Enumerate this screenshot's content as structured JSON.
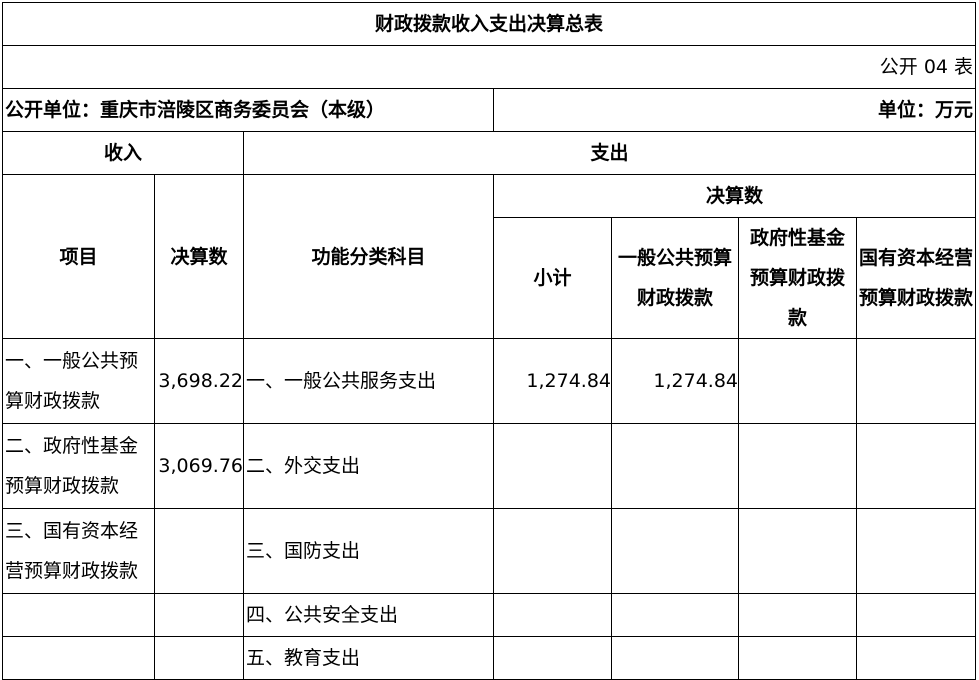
{
  "title": "财政拨款收入支出决算总表",
  "table_no": "公开 04 表",
  "unit_org": "公开单位：重庆市涪陵区商务委员会（本级）",
  "unit": "单位：万元",
  "headers": {
    "income": "收入",
    "expense": "支出",
    "item": "项目",
    "amount": "决算数",
    "func": "功能分类科目",
    "final": "决算数",
    "subtotal": "小计",
    "general": "一般公共预算财政拨款",
    "gov_fund": "政府性基金预算财政拨款",
    "state_capital": "国有资本经营预算财政拨款"
  },
  "rows": [
    {
      "income_item": "一、一般公共预算财政拨款",
      "income_amount": "3,698.22",
      "func": "一、一般公共服务支出",
      "subtotal": "1,274.84",
      "general": "1,274.84",
      "gov_fund": "",
      "state_capital": ""
    },
    {
      "income_item": "二、政府性基金预算财政拨款",
      "income_amount": "3,069.76",
      "func": "二、外交支出",
      "subtotal": "",
      "general": "",
      "gov_fund": "",
      "state_capital": ""
    },
    {
      "income_item": "三、国有资本经营预算财政拨款",
      "income_amount": "",
      "func": "三、国防支出",
      "subtotal": "",
      "general": "",
      "gov_fund": "",
      "state_capital": ""
    },
    {
      "income_item": "",
      "income_amount": "",
      "func": "四、公共安全支出",
      "subtotal": "",
      "general": "",
      "gov_fund": "",
      "state_capital": ""
    },
    {
      "income_item": "",
      "income_amount": "",
      "func": "五、教育支出",
      "subtotal": "",
      "general": "",
      "gov_fund": "",
      "state_capital": ""
    }
  ]
}
